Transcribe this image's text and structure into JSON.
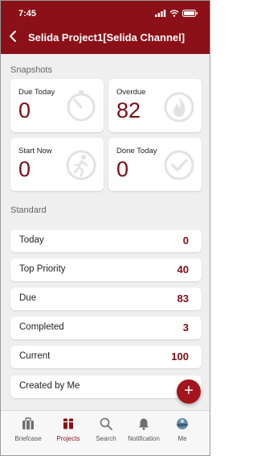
{
  "status_bar": {
    "time": "7:45"
  },
  "header": {
    "title": "Selida Project1[Selida Channel]",
    "back_icon": "chevron-left-icon"
  },
  "colors": {
    "brand": "#8c1018",
    "accent_text": "#7a0e16",
    "background": "#efefef"
  },
  "snapshots": {
    "label": "Snapshots",
    "cards": [
      {
        "label": "Due Today",
        "value": "0",
        "icon": "timer-icon"
      },
      {
        "label": "Overdue",
        "value": "82",
        "icon": "fire-icon"
      },
      {
        "label": "Start Now",
        "value": "0",
        "icon": "running-person-icon"
      },
      {
        "label": "Done Today",
        "value": "0",
        "icon": "checkmark-circle-icon"
      }
    ]
  },
  "standard": {
    "label": "Standard",
    "rows": [
      {
        "label": "Today",
        "count": "0"
      },
      {
        "label": "Top Priority",
        "count": "40"
      },
      {
        "label": "Due",
        "count": "83"
      },
      {
        "label": "Completed",
        "count": "3"
      },
      {
        "label": "Current",
        "count": "100"
      },
      {
        "label": "Created by Me",
        "count": ""
      }
    ]
  },
  "fab": {
    "label": "+"
  },
  "tabs": [
    {
      "label": "Briefcase",
      "icon": "briefcase-icon"
    },
    {
      "label": "Projects",
      "icon": "projects-icon",
      "active": true
    },
    {
      "label": "Search",
      "icon": "search-icon"
    },
    {
      "label": "Notification",
      "icon": "bell-icon"
    },
    {
      "label": "Me",
      "icon": "avatar-icon"
    }
  ]
}
